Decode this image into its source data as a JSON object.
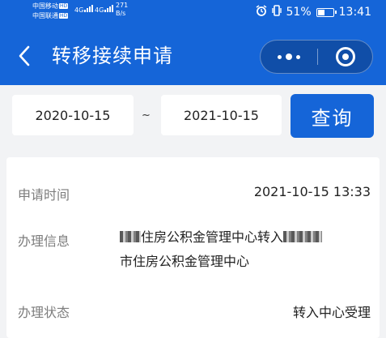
{
  "statusbar": {
    "carrier1": "中国移动",
    "carrier2": "中国联通",
    "hd_badge": "HD",
    "net1": "4G",
    "net2": "4G",
    "speed_value": "271",
    "speed_unit": "B/s",
    "battery": "51%",
    "battery_level": 0.51,
    "time": "13:41"
  },
  "navbar": {
    "title": "转移接续申请"
  },
  "filter": {
    "start_date": "2020-10-15",
    "separator": "~",
    "end_date": "2021-10-15",
    "query_label": "查询"
  },
  "record": {
    "time_label": "申请时间",
    "time_value": "2021-10-15 13:33",
    "info_label": "办理信息",
    "info_line1": "住房公积金管理中心转入",
    "info_line2": "市住房公积金管理中心",
    "status_label": "办理状态",
    "status_value": "转入中心受理"
  },
  "colors": {
    "primary": "#1565d8",
    "background": "#f2f3f5",
    "label": "#7d7d7d"
  }
}
